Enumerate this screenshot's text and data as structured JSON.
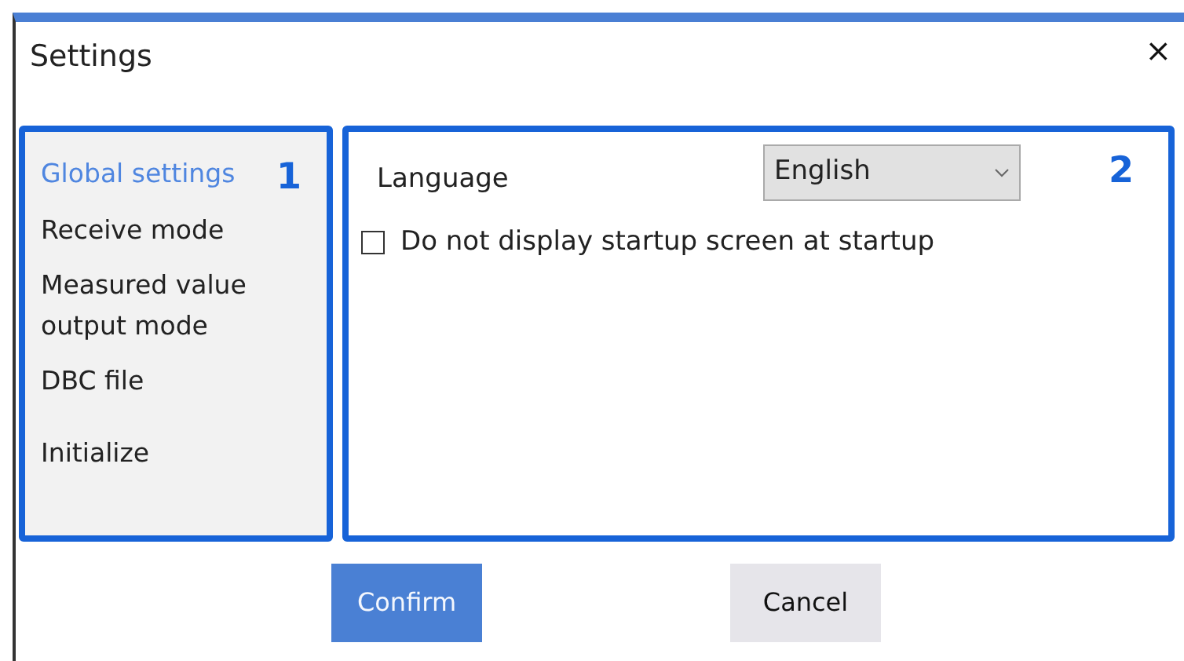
{
  "window": {
    "title": "Settings",
    "close": "×"
  },
  "sidebar": {
    "callout": "1",
    "items": [
      {
        "label": "Global settings",
        "selected": true
      },
      {
        "label": "Receive mode",
        "selected": false
      },
      {
        "label": "Measured value output mode",
        "selected": false
      },
      {
        "label": "DBC file",
        "selected": false
      },
      {
        "label": "Initialize",
        "selected": false
      }
    ]
  },
  "panel": {
    "callout": "2",
    "language": {
      "label": "Language",
      "value": "English"
    },
    "startup_checkbox": {
      "label": "Do not display startup screen at startup",
      "checked": false
    }
  },
  "buttons": [
    {
      "label": "Confirm",
      "kind": "primary"
    },
    {
      "label": "Cancel",
      "kind": "secondary"
    }
  ]
}
